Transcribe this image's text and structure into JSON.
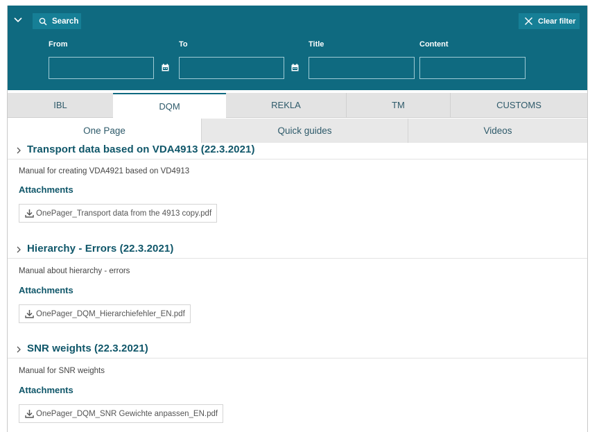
{
  "filter": {
    "search_label": "Search",
    "clear_label": "Clear filter",
    "from_label": "From",
    "to_label": "To",
    "title_label": "Title",
    "content_label": "Content",
    "from_value": "",
    "to_value": "",
    "title_value": "",
    "content_value": ""
  },
  "main_tabs": [
    {
      "label": "IBL"
    },
    {
      "label": "DQM",
      "active": true
    },
    {
      "label": "REKLA"
    },
    {
      "label": "TM"
    },
    {
      "label": "CUSTOMS"
    }
  ],
  "sub_tabs": [
    {
      "label": "One Page",
      "active": true
    },
    {
      "label": "Quick guides"
    },
    {
      "label": "Videos"
    }
  ],
  "sections": [
    {
      "title": "Transport data based on VDA4913 (22.3.2021)",
      "description": "Manual for creating VDA4921 based on VD4913",
      "attachments_label": "Attachments",
      "file": "OnePager_Transport data from the 4913 copy.pdf"
    },
    {
      "title": "Hierarchy - Errors (22.3.2021)",
      "description": "Manual about hierarchy - errors",
      "attachments_label": "Attachments",
      "file": "OnePager_DQM_Hierarchiefehler_EN.pdf"
    },
    {
      "title": "SNR weights (22.3.2021)",
      "description": "Manual for SNR weights",
      "attachments_label": "Attachments",
      "file": "OnePager_DQM_SNR Gewichte anpassen_EN.pdf"
    }
  ],
  "colors": {
    "header_bg": "#0f6a80",
    "button_bg": "#167f96",
    "title_color": "#0f5669"
  },
  "icons": [
    "chevron-down-icon",
    "search-icon",
    "close-icon",
    "calendar-icon",
    "chevron-right-icon",
    "download-icon"
  ]
}
